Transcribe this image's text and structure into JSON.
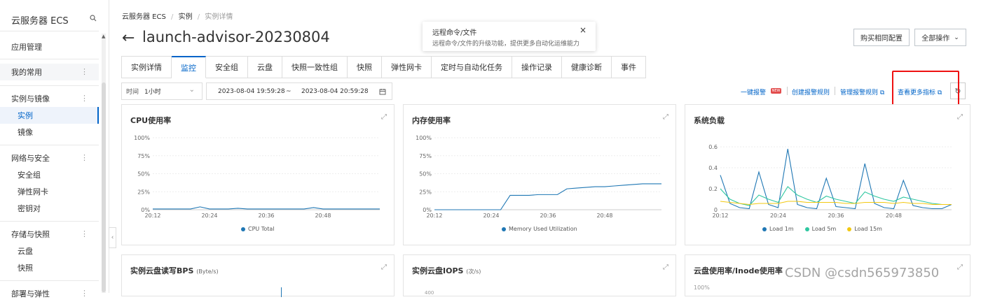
{
  "sidebar": {
    "title": "云服务器 ECS",
    "search_icon": "search-icon",
    "items": [
      {
        "label": "应用管理",
        "type": "top"
      },
      {
        "label": "我的常用",
        "type": "top"
      },
      {
        "label": "实例与镜像",
        "type": "group"
      },
      {
        "label": "实例",
        "type": "sub",
        "active": true
      },
      {
        "label": "镜像",
        "type": "sub"
      },
      {
        "label": "网络与安全",
        "type": "group"
      },
      {
        "label": "安全组",
        "type": "sub"
      },
      {
        "label": "弹性网卡",
        "type": "sub"
      },
      {
        "label": "密钥对",
        "type": "sub"
      },
      {
        "label": "存储与快照",
        "type": "group"
      },
      {
        "label": "云盘",
        "type": "sub"
      },
      {
        "label": "快照",
        "type": "sub"
      },
      {
        "label": "部署与弹性",
        "type": "group"
      }
    ]
  },
  "breadcrumb": [
    "云服务器 ECS",
    "实例",
    "实例详情"
  ],
  "breadcrumb_sep": "/",
  "page_title": "launch-advisor-20230804",
  "tooltip": {
    "title": "远程命令/文件",
    "body": "远程命令/文件的升级功能，提供更多自动化运维能力"
  },
  "header_buttons": {
    "buy_same": "购买相同配置",
    "all_actions": "全部操作"
  },
  "tabs": [
    "实例详情",
    "监控",
    "安全组",
    "云盘",
    "快照一致性组",
    "快照",
    "弹性网卡",
    "定时与自动化任务",
    "操作记录",
    "健康诊断",
    "事件"
  ],
  "active_tab": "监控",
  "toolbar": {
    "time_label": "时间",
    "time_value": "1小时",
    "range_start": "2023-08-04 19:59:28",
    "range_sep": "~",
    "range_end": "2023-08-04 20:59:28",
    "alarm_link": "一键报警",
    "new_badge": "NEW",
    "create_rule": "创建报警规则",
    "manage_rule": "管理报警规则",
    "more_metrics": "查看更多指标"
  },
  "colors": {
    "accent": "#0064c8",
    "series_blue": "#1f77b4",
    "series_green": "#2ec7a0",
    "series_yellow": "#f2c811",
    "highlight_red": "#ee1111"
  },
  "charts": [
    {
      "title": "CPU使用率",
      "unit": "",
      "legend": [
        {
          "name": "CPU Total",
          "color": "#1f77b4"
        }
      ]
    },
    {
      "title": "内存使用率",
      "unit": "",
      "legend": [
        {
          "name": "Memory Used Utilization",
          "color": "#1f77b4"
        }
      ]
    },
    {
      "title": "系统负载",
      "unit": "",
      "legend": [
        {
          "name": "Load 1m",
          "color": "#1f77b4"
        },
        {
          "name": "Load 5m",
          "color": "#2ec7a0"
        },
        {
          "name": "Load 15m",
          "color": "#f2c811"
        }
      ]
    },
    {
      "title": "实例云盘读写BPS",
      "unit": "(Byte/s)"
    },
    {
      "title": "实例云盘IOPS",
      "unit": "(次/s)"
    },
    {
      "title": "云盘使用率/Inode使用率",
      "unit": ""
    }
  ],
  "chart_data": [
    {
      "type": "line",
      "title": "CPU使用率",
      "x": [
        "20:12",
        "20:14",
        "20:16",
        "20:18",
        "20:20",
        "20:22",
        "20:24",
        "20:26",
        "20:28",
        "20:30",
        "20:32",
        "20:34",
        "20:36",
        "20:38",
        "20:40",
        "20:42",
        "20:44",
        "20:46",
        "20:48",
        "20:50",
        "20:52",
        "20:54",
        "20:56",
        "20:58",
        "21:00"
      ],
      "yticks": [
        "0%",
        "25%",
        "50%",
        "75%",
        "100%"
      ],
      "xticks": [
        "20:12",
        "20:24",
        "20:36",
        "20:48"
      ],
      "ylim": [
        0,
        100
      ],
      "series": [
        {
          "name": "CPU Total",
          "values": [
            1,
            1,
            1,
            1,
            1,
            4,
            1,
            1,
            1,
            2,
            1,
            1,
            1,
            1,
            1,
            1,
            1,
            3,
            1,
            1,
            1,
            1,
            1,
            1,
            1
          ]
        }
      ]
    },
    {
      "type": "line",
      "title": "内存使用率",
      "x": [
        "20:12",
        "20:14",
        "20:16",
        "20:18",
        "20:20",
        "20:22",
        "20:24",
        "20:26",
        "20:28",
        "20:30",
        "20:32",
        "20:34",
        "20:36",
        "20:38",
        "20:40",
        "20:42",
        "20:44",
        "20:46",
        "20:48",
        "20:50",
        "20:52",
        "20:54",
        "20:56",
        "20:58",
        "21:00"
      ],
      "yticks": [
        "0%",
        "25%",
        "50%",
        "75%",
        "100%"
      ],
      "xticks": [
        "20:12",
        "20:24",
        "20:36",
        "20:48"
      ],
      "ylim": [
        0,
        100
      ],
      "series": [
        {
          "name": "Memory Used Utilization",
          "values": [
            0,
            0,
            0,
            0,
            0,
            0,
            0,
            0,
            20,
            20,
            20,
            21,
            21,
            21,
            29,
            30,
            31,
            32,
            32,
            33,
            34,
            35,
            36,
            36,
            36
          ]
        }
      ]
    },
    {
      "type": "line",
      "title": "系统负载",
      "x": [
        "20:12",
        "20:14",
        "20:16",
        "20:18",
        "20:20",
        "20:22",
        "20:24",
        "20:26",
        "20:28",
        "20:30",
        "20:32",
        "20:34",
        "20:36",
        "20:38",
        "20:40",
        "20:42",
        "20:44",
        "20:46",
        "20:48",
        "20:50",
        "20:52",
        "20:54",
        "20:56",
        "20:58",
        "21:00"
      ],
      "yticks": [
        "0",
        "0.2",
        "0.4",
        "0.6"
      ],
      "xticks": [
        "20:12",
        "20:24",
        "20:36",
        "20:48"
      ],
      "ylim": [
        0,
        0.7
      ],
      "series": [
        {
          "name": "Load 1m",
          "values": [
            0.33,
            0.06,
            0.02,
            0.01,
            0.36,
            0.05,
            0.02,
            0.58,
            0.05,
            0.02,
            0.01,
            0.3,
            0.03,
            0.02,
            0.01,
            0.44,
            0.06,
            0.02,
            0.01,
            0.28,
            0.04,
            0.02,
            0.01,
            0.01,
            0.05
          ]
        },
        {
          "name": "Load 5m",
          "values": [
            0.2,
            0.1,
            0.06,
            0.04,
            0.14,
            0.1,
            0.07,
            0.22,
            0.14,
            0.1,
            0.07,
            0.13,
            0.1,
            0.08,
            0.06,
            0.17,
            0.13,
            0.1,
            0.08,
            0.12,
            0.1,
            0.08,
            0.06,
            0.05,
            0.05
          ]
        },
        {
          "name": "Load 15m",
          "values": [
            0.08,
            0.07,
            0.06,
            0.05,
            0.06,
            0.06,
            0.06,
            0.08,
            0.08,
            0.07,
            0.07,
            0.07,
            0.07,
            0.06,
            0.06,
            0.07,
            0.07,
            0.07,
            0.06,
            0.07,
            0.06,
            0.06,
            0.05,
            0.05,
            0.05
          ]
        }
      ]
    }
  ],
  "bottom_charts": {
    "iops_tick": "400",
    "disk_tick": "100%"
  },
  "watermark": "CSDN @csdn565973850"
}
